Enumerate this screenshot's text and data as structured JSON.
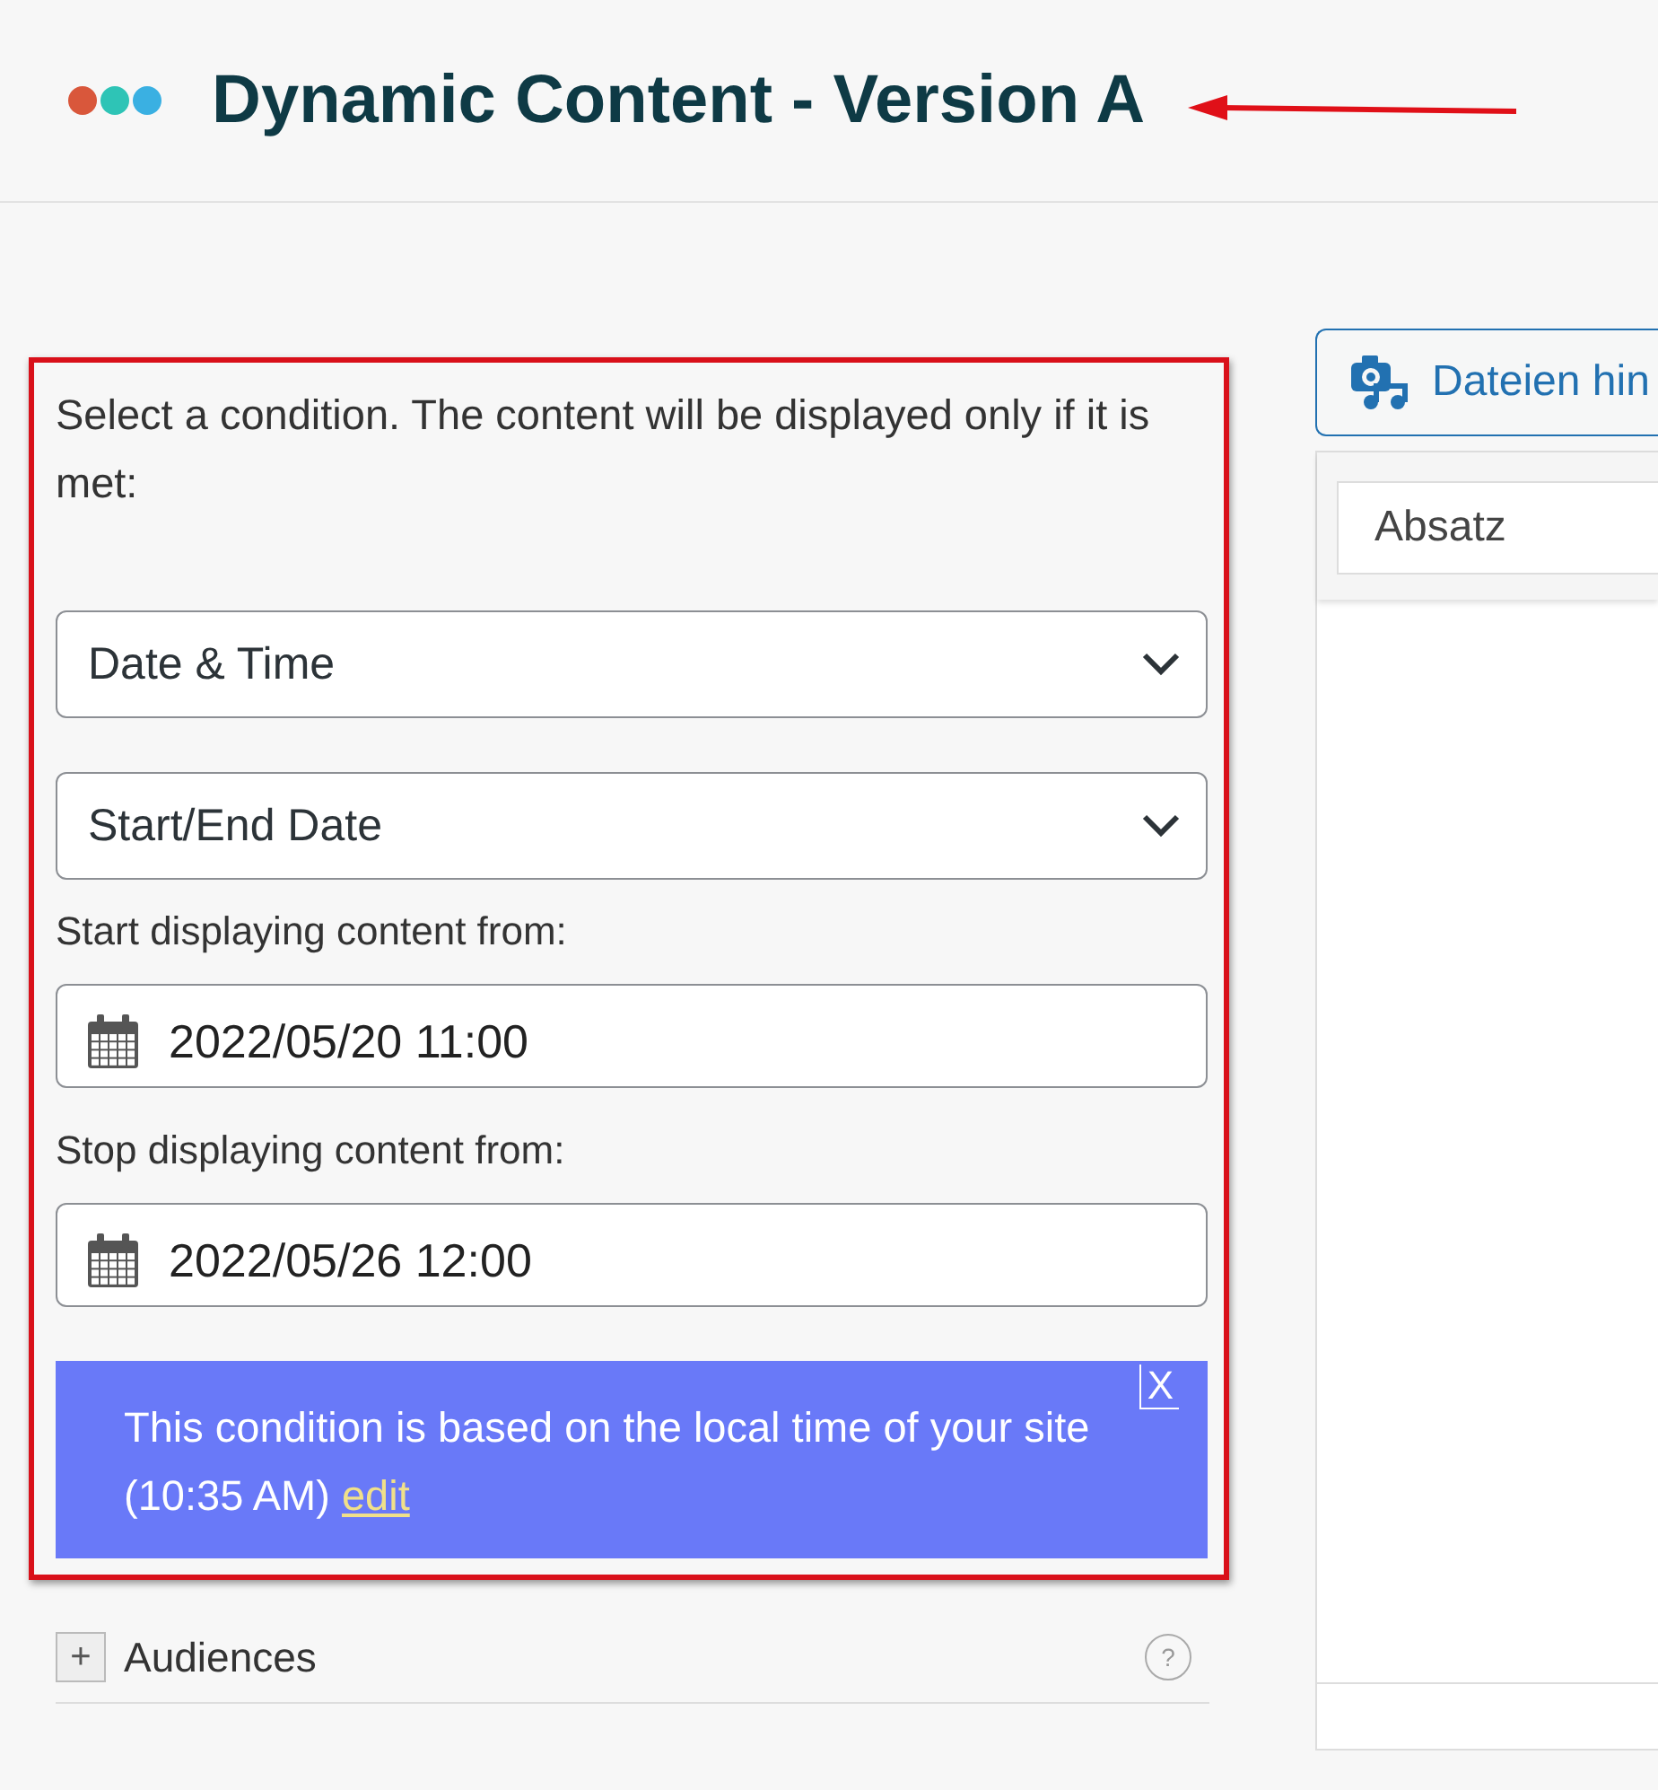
{
  "header": {
    "title": "Dynamic Content - Version A",
    "logo_dots": [
      {
        "color": "#d9573b"
      },
      {
        "color": "#2ec4b6"
      },
      {
        "color": "#3ab0e2"
      }
    ]
  },
  "condition_panel": {
    "intro": "Select a condition. The content will be displayed only if it is met:",
    "selects": [
      {
        "value": "Date & Time"
      },
      {
        "value": "Start/End Date"
      }
    ],
    "date_fields": [
      {
        "label": "Start displaying content from:",
        "value": "2022/05/20 11:00"
      },
      {
        "label": "Stop displaying content from:",
        "value": "2022/05/26 12:00"
      }
    ],
    "notice": {
      "text": "This condition is based on the local time of your site (10:35 AM)",
      "link": "edit",
      "close": "X"
    }
  },
  "audiences": {
    "expand": "+",
    "label": "Audiences",
    "help": "?"
  },
  "editor": {
    "add_media_button": "Dateien hin",
    "format_select": "Absatz"
  }
}
